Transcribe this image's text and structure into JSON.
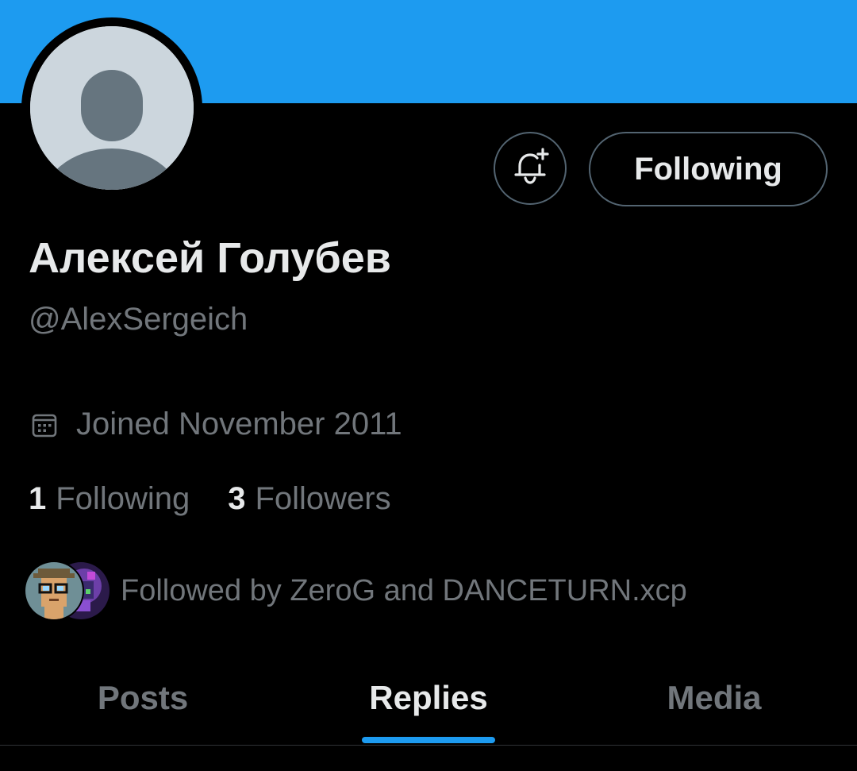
{
  "colors": {
    "banner": "#1d9bf0",
    "background": "#000000",
    "primary_text": "#e7e9ea",
    "secondary_text": "#71767b",
    "accent": "#1d9bf0",
    "border": "#536471"
  },
  "profile": {
    "display_name": "Алексей Голубев",
    "handle": "@AlexSergeich",
    "joined": "Joined November 2011",
    "avatar_icon": "default-avatar-icon"
  },
  "actions": {
    "notify_icon": "bell-plus-icon",
    "following_label": "Following"
  },
  "stats": {
    "following_count": "1",
    "following_label": "Following",
    "followers_count": "3",
    "followers_label": "Followers"
  },
  "followed_by": {
    "text": "Followed by ZeroG and DANCETURN.xcp"
  },
  "tabs": [
    {
      "label": "Posts",
      "active": false
    },
    {
      "label": "Replies",
      "active": true
    },
    {
      "label": "Media",
      "active": false
    }
  ]
}
